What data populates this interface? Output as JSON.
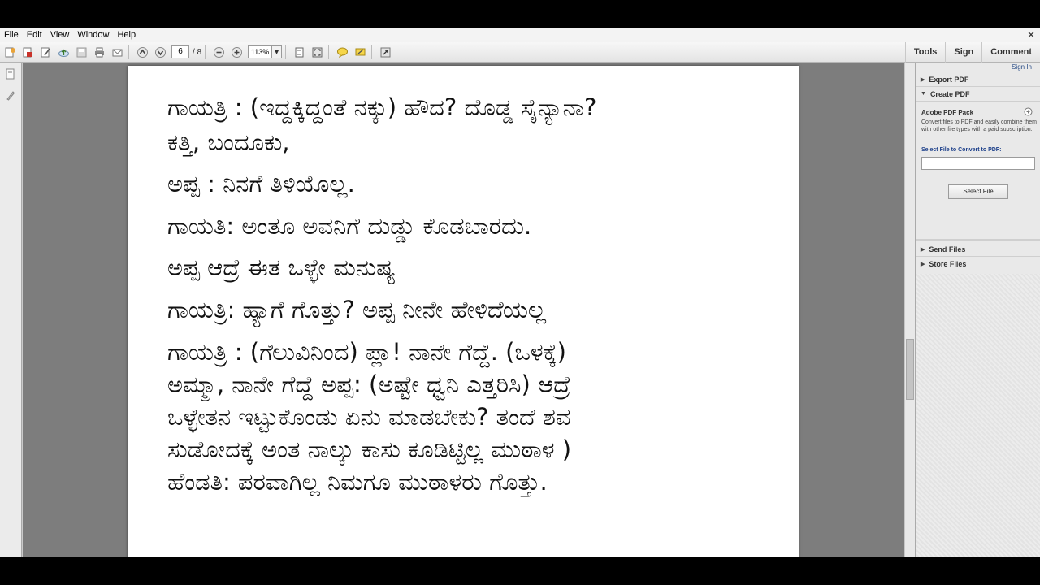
{
  "menu": {
    "items": [
      "File",
      "Edit",
      "View",
      "Window",
      "Help"
    ],
    "close_glyph": "✕"
  },
  "toolbar": {
    "page_current": "6",
    "page_total": "/ 8",
    "zoom": "113%",
    "tools_label": "Tools",
    "sign_label": "Sign",
    "comment_label": "Comment"
  },
  "document": {
    "lines": [
      "ಗಾಯತ್ರಿ : (ಇದ್ದಕ್ಕಿದ್ದಂತೆ ನಕ್ಕು) ಹೌದ? ದೊಡ್ಡ ಸೈನ್ಯಾನಾ?",
      "ಕತ್ತಿ, ಬಂದೂಕು,",
      "ಅಪ್ಪ  : ನಿನಗೆ ತಿಳಿಯೊಲ್ಲ.",
      "ಗಾಯತಿ: ಅಂತೂ ಅವನಿಗೆ ದುಡ್ಡು ಕೊಡಬಾರದು.",
      "ಅಪ್ಪ ಆದ್ರೆ ಈತ ಒಳ್ಳೇ ಮನುಷ್ಯ",
      "ಗಾಯತ್ರಿ: ಹ್ಯಾಗೆ ಗೊತ್ತು? ಅಪ್ಪ ನೀನೇ ಹೇಳಿದೆಯಲ್ಲ",
      "ಗಾಯತ್ರಿ : (ಗೆಲುವಿನಿಂದ) ಪ್ಲಾ! ನಾನೇ ಗೆದ್ದೆ. (ಒಳಕ್ಕೆ)",
      "ಅಮ್ಮಾ, ನಾನೇ ಗೆದ್ದೆ ಅಪ್ಪ: (ಅಷ್ಟೇ ಧ್ವನಿ ಎತ್ತರಿಸಿ) ಆದ್ರೆ",
      "ಒಳ್ಳೇತನ ಇಟ್ಟುಕೊಂಡು ಏನು ಮಾಡಬೇಕು? ತಂದೆ ಶವ",
      "ಸುಡೋದಕ್ಕೆ ಅಂತ ನಾಲ್ಕು ಕಾಸು ಕೂಡಿಟ್ಟಿಲ್ಲ ಮುಠಾಳ )",
      "ಹೆಂಡತಿ: ಪರವಾಗಿಲ್ಲ ನಿಮಗೂ ಮುಠಾಳರು ಗೊತ್ತು."
    ]
  },
  "rightpane": {
    "sign_in": "Sign In",
    "export_pdf": "Export PDF",
    "create_pdf": "Create PDF",
    "pack_title": "Adobe PDF Pack",
    "pack_desc": "Convert files to PDF and easily combine them with other file types with a paid subscription.",
    "select_label": "Select File to Convert to PDF:",
    "select_button": "Select File",
    "send_files": "Send Files",
    "store_files": "Store Files"
  }
}
